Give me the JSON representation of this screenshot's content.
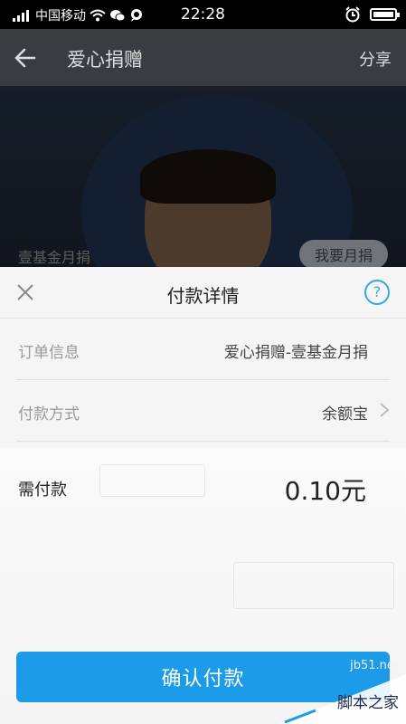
{
  "status_bar": {
    "carrier": "中国移动",
    "time": "22:28"
  },
  "nav": {
    "title": "爱心捐赠",
    "share": "分享"
  },
  "hero": {
    "label": "壹基金月捐",
    "button": "我要月捐"
  },
  "sheet": {
    "title": "付款详情",
    "help_symbol": "?",
    "rows": [
      {
        "label": "订单信息",
        "value": "爱心捐赠-壹基金月捐"
      },
      {
        "label": "付款方式",
        "value": "余额宝"
      }
    ],
    "amount_label": "需付款",
    "amount_value": "0.10元",
    "confirm_label": "确认付款"
  },
  "watermark": {
    "url": "jb51.net",
    "text": "脚本之家"
  },
  "colors": {
    "accent": "#1b9be8",
    "help": "#35a8e0"
  }
}
